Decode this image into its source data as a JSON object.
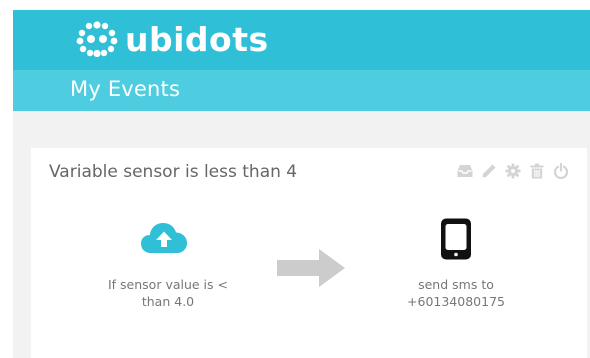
{
  "brand": {
    "name": "ubidots",
    "color": "#2fbfd6"
  },
  "subheader": {
    "title": "My Events",
    "color": "#4ecde0"
  },
  "event": {
    "title": "Variable sensor is less than 4",
    "toolbar": [
      {
        "icon": "inbox-icon"
      },
      {
        "icon": "pencil-icon"
      },
      {
        "icon": "gear-icon"
      },
      {
        "icon": "trash-icon"
      },
      {
        "icon": "power-icon"
      }
    ],
    "trigger": {
      "icon": "cloud-upload-icon",
      "line1": "If sensor value is <",
      "line2": "than 4.0"
    },
    "action": {
      "icon": "smartphone-icon",
      "line1": "send sms to",
      "line2": "+60134080175"
    }
  }
}
